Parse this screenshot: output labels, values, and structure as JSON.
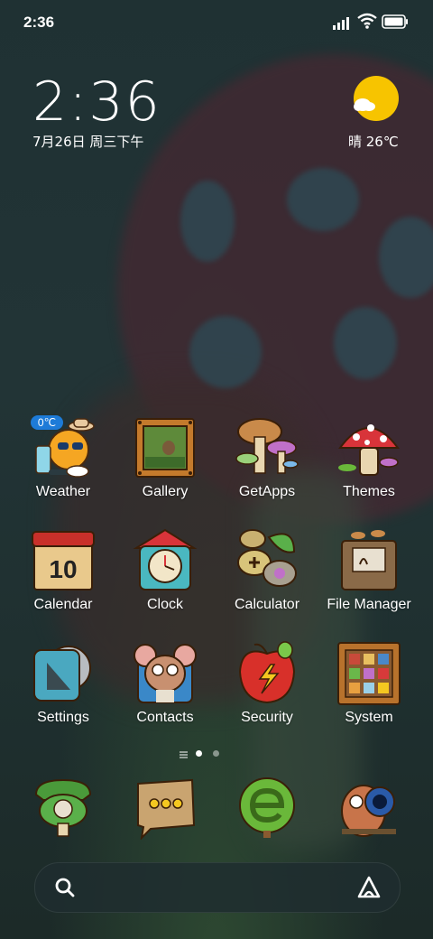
{
  "status_bar": {
    "time": "2:36"
  },
  "clock_widget": {
    "time": "2:36",
    "date": "7月26日 周三下午"
  },
  "weather_widget": {
    "text": "晴 26℃",
    "icon": "sun-with-cloud-icon"
  },
  "apps": [
    {
      "label": "Weather",
      "icon": "weather-icon",
      "badge": "0℃"
    },
    {
      "label": "Gallery",
      "icon": "gallery-icon"
    },
    {
      "label": "GetApps",
      "icon": "getapps-icon"
    },
    {
      "label": "Themes",
      "icon": "themes-icon"
    },
    {
      "label": "Calendar",
      "icon": "calendar-icon",
      "badge": "10"
    },
    {
      "label": "Clock",
      "icon": "clock-icon"
    },
    {
      "label": "Calculator",
      "icon": "calculator-icon"
    },
    {
      "label": "File Manager",
      "icon": "file-manager-icon"
    },
    {
      "label": "Settings",
      "icon": "settings-icon"
    },
    {
      "label": "Contacts",
      "icon": "contacts-icon"
    },
    {
      "label": "Security",
      "icon": "security-icon"
    },
    {
      "label": "System",
      "icon": "system-icon"
    }
  ],
  "dock": [
    {
      "icon": "phone-icon"
    },
    {
      "icon": "messages-icon"
    },
    {
      "icon": "browser-icon"
    },
    {
      "icon": "camera-icon"
    }
  ],
  "search_bar": {
    "left_icon": "search-icon",
    "right_icon": "assistant-icon"
  },
  "colors": {
    "background": "#1f3133",
    "text": "#ffffff",
    "sun": "#f7c400"
  }
}
